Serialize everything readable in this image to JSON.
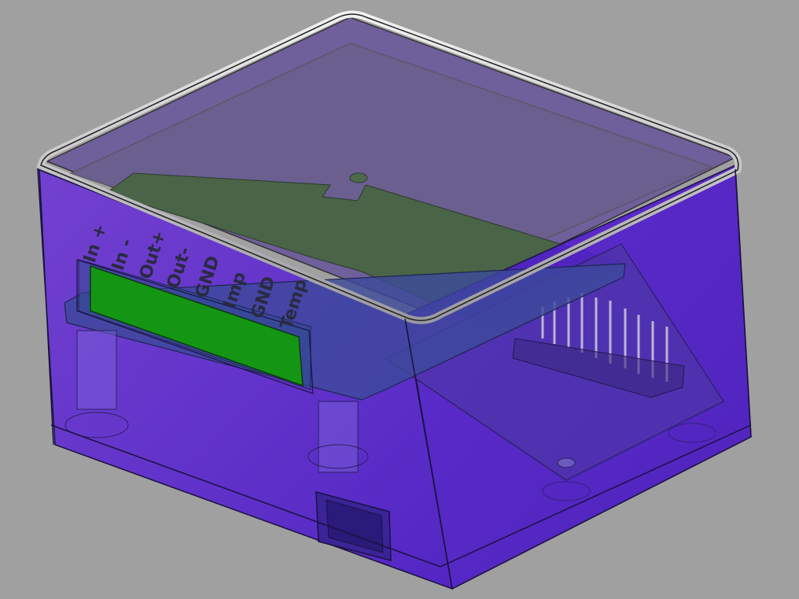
{
  "scene": {
    "background": "#a0a0a0",
    "enclosure_color": "#5a1fd6",
    "lid_color": "#c8b8e6",
    "pcb_color": "#3d6a38",
    "display_color": "#149614",
    "board_color": "#3c4aa0"
  },
  "terminal_labels": [
    "In +",
    "In -",
    "Out+",
    "Out-",
    "GND",
    "Imp",
    "GND",
    "Temp"
  ]
}
